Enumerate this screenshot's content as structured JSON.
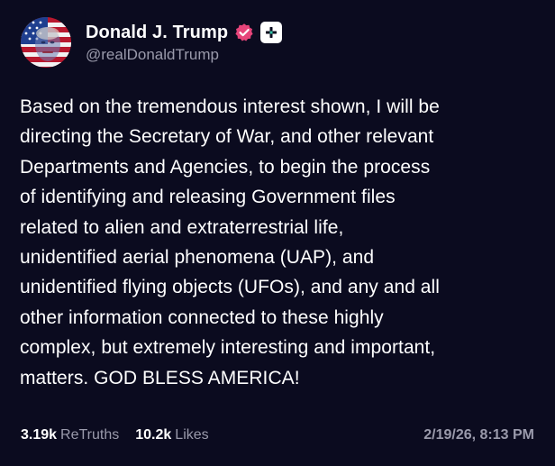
{
  "post": {
    "author": {
      "display_name": "Donald J. Trump",
      "handle": "@realDonaldTrump",
      "avatar_icon": "flag-portrait-avatar",
      "verified_icon": "verified-badge-icon",
      "follow_icon": "plus-icon"
    },
    "text": "Based on the tremendous interest shown, I will be\ndirecting the Secretary of War, and other relevant\nDepartments and Agencies, to begin the process\nof identifying and releasing Government files\nrelated to alien and extraterrestrial life,\nunidentified aerial phenomena (UAP), and\nunidentified flying objects (UFOs), and any and all\nother information connected to these highly\ncomplex, but extremely interesting and important,\nmatters. GOD BLESS AMERICA!",
    "stats": {
      "retruths_count": "3.19k",
      "retruths_label": "ReTruths",
      "likes_count": "10.2k",
      "likes_label": "Likes"
    },
    "timestamp": "2/19/26, 8:13 PM"
  },
  "colors": {
    "background": "#0b0b1f",
    "text": "#ffffff",
    "secondary_text": "#9a9aab",
    "verified_badge": "#e6447a"
  }
}
